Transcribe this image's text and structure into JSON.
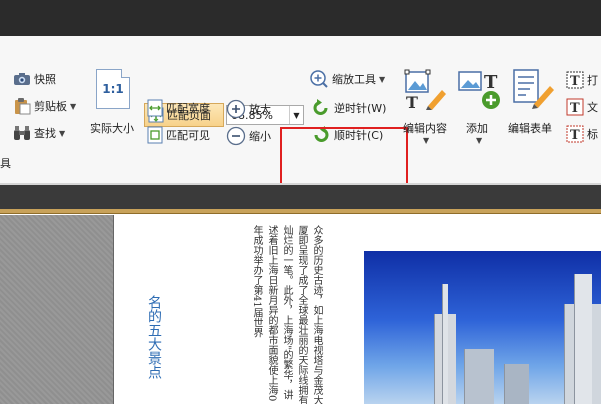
{
  "toolbar": {
    "snapshot": "快照",
    "clipboard": "剪贴板",
    "find": "查找",
    "tools_partial": "具",
    "actual_size": "实际大小",
    "actual_size_icon_text": "1:1",
    "fit_page": "匹配页面",
    "fit_width": "匹配宽度",
    "fit_visible": "匹配可见",
    "zoom_value": "68.85%",
    "zoom_in": "放大",
    "zoom_out": "缩小",
    "zoom_tool": "缩放工具",
    "rotate_ccw": "逆时针(W)",
    "rotate_cw": "顺时针(C)",
    "edit_content": "编辑内容",
    "add": "添加",
    "edit_form": "编辑表单",
    "print_partial": "打",
    "text_partial": "文",
    "mark_partial": "标"
  },
  "document": {
    "vertical_title": "名的五大景点",
    "vertical_text": "众多的历史古迹，如上海电视塔与金茂大厦即呈现了成了全球最壮丽的天际线拥有灿烂的一笔。此外，上海场\"的繁华，讲述着旧上海日新月异的都市面貌使上海0年成功举办了第41届世界"
  },
  "colors": {
    "accent_green": "#4a9b2c",
    "highlight_red": "#e02020",
    "ribbon_bg": "#f7f7f7"
  }
}
